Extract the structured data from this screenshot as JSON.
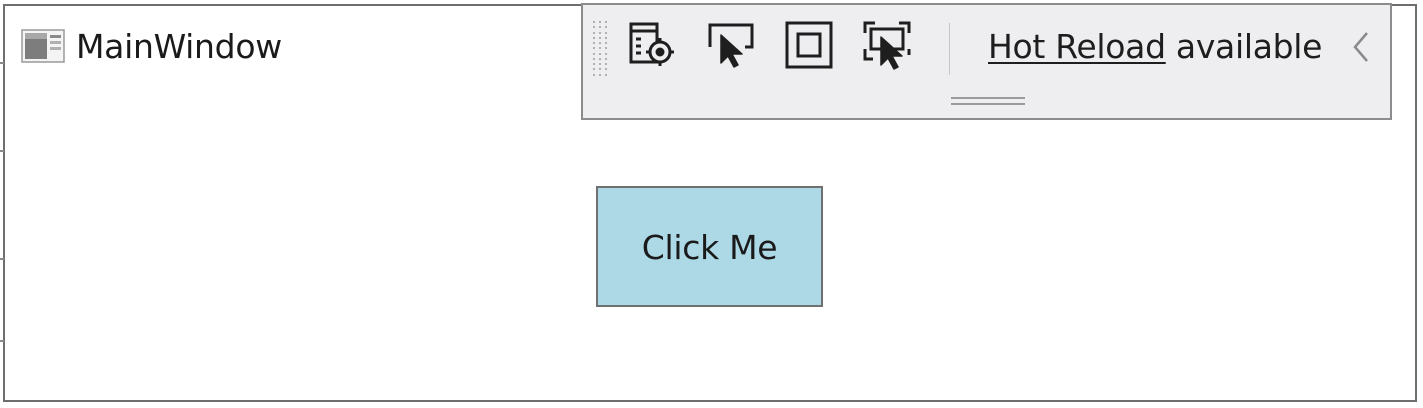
{
  "window": {
    "title": "MainWindow",
    "icon": "app-window-icon",
    "background": "#ffffff"
  },
  "toolbar": {
    "tools": [
      {
        "name": "live-visual-tree-icon",
        "label": ""
      },
      {
        "name": "select-element-icon",
        "label": ""
      },
      {
        "name": "display-layout-adorners-icon",
        "label": ""
      },
      {
        "name": "track-focused-element-icon",
        "label": ""
      }
    ],
    "hot_reload_link": "Hot Reload",
    "hot_reload_status": " available",
    "collapse_icon": "chevron-left-icon",
    "background": "#eeeef0"
  },
  "main": {
    "button_label": "Click Me",
    "button_color": "#add8e6"
  }
}
